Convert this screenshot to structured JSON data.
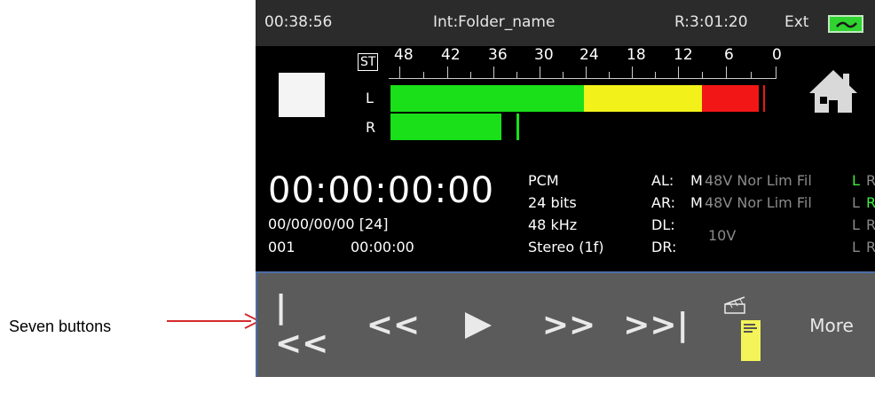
{
  "annotation": {
    "label": "Seven buttons"
  },
  "status": {
    "time": "00:38:56",
    "folder": "Int:Folder_name",
    "remaining": "R:3:01:20",
    "clock": "Ext"
  },
  "meter": {
    "st_label": "ST",
    "scale": [
      "48",
      "42",
      "36",
      "30",
      "24",
      "18",
      "12",
      "6",
      "0"
    ],
    "channels": {
      "left": "L",
      "right": "R"
    },
    "levels": {
      "left_db": -2,
      "right_db": -35,
      "right_peak_db": -33
    }
  },
  "timecode": {
    "main": "00:00:00:00",
    "date": "00/00/00/00 [24]",
    "take": "001",
    "duration": "00:00:00"
  },
  "format": {
    "codec": "PCM",
    "bits": "24 bits",
    "rate": "48 kHz",
    "mode": "Stereo (1f)"
  },
  "channels": {
    "al": {
      "label": "AL:",
      "mode": "M",
      "opts": "48V Nor Lim Fil",
      "l": "L",
      "r": "R"
    },
    "ar": {
      "label": "AR:",
      "mode": "M",
      "opts": "48V Nor Lim Fil",
      "l": "L",
      "r": "R"
    },
    "dl": {
      "label": "DL:",
      "value": "10V",
      "l": "L",
      "r": "R"
    },
    "dr": {
      "label": "DR:",
      "l": "L",
      "r": "R"
    }
  },
  "buttons": {
    "rewind_start": "|<<",
    "rewind": "<<",
    "forward": ">>",
    "forward_end": ">>|",
    "slate_note": "Project field\nScene field\nTake #",
    "more": "More"
  },
  "colors": {
    "green": "#19e019",
    "yellow": "#f2f21a",
    "red": "#f21616",
    "bar": "#5b5b5b",
    "border": "#4b6ea8"
  }
}
